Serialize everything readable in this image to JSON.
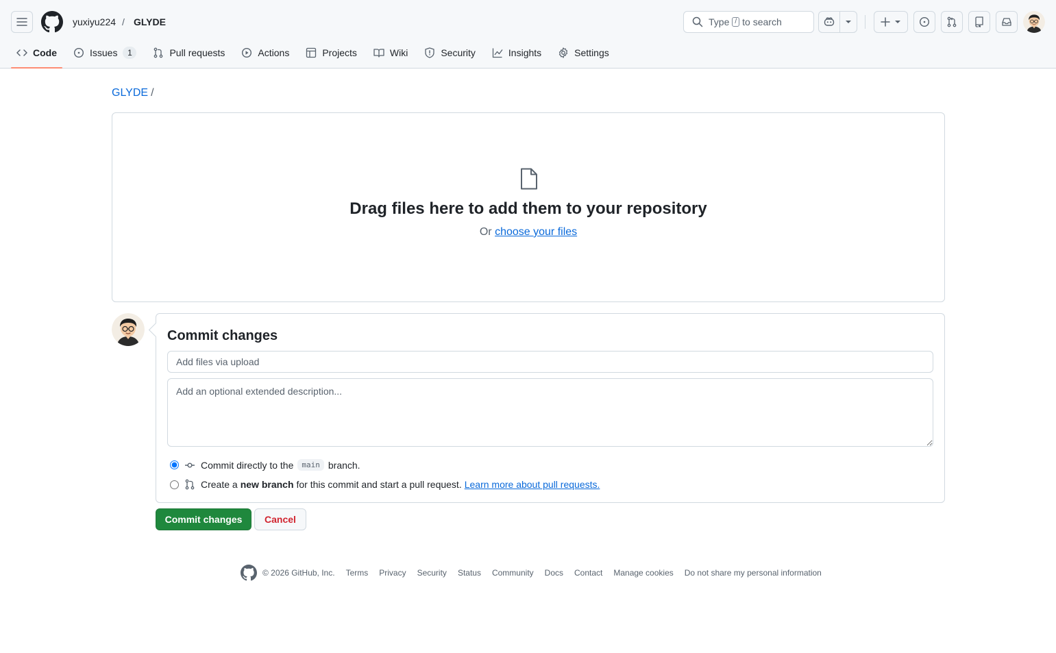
{
  "header": {
    "owner": "yuxiyu224",
    "separator": "/",
    "repo": "GLYDE",
    "search": {
      "prefix": "Type",
      "key": "/",
      "suffix": "to search"
    },
    "icons": [
      "hamburger-icon",
      "github-logo-icon",
      "search-icon",
      "copilot-icon",
      "chevron-down-icon",
      "plus-icon",
      "issue-opened-icon",
      "git-pull-request-icon",
      "repo-icon",
      "inbox-icon"
    ]
  },
  "nav": {
    "code": "Code",
    "issues": "Issues",
    "issues_count": "1",
    "pulls": "Pull requests",
    "actions": "Actions",
    "projects": "Projects",
    "wiki": "Wiki",
    "security": "Security",
    "insights": "Insights",
    "settings": "Settings"
  },
  "breadcrumb": {
    "repo": "GLYDE",
    "sep": "/"
  },
  "dropzone": {
    "title": "Drag files here to add them to your repository",
    "or": "Or",
    "choose": "choose your files"
  },
  "commit": {
    "title": "Commit changes",
    "message_placeholder": "Add files via upload",
    "description_placeholder": "Add an optional extended description...",
    "option1_prefix": "Commit directly to the",
    "option1_branch": "main",
    "option1_suffix": "branch.",
    "option2_prefix": "Create a",
    "option2_bold": "new branch",
    "option2_suffix": "for this commit and start a pull request.",
    "option2_link": "Learn more about pull requests.",
    "submit": "Commit changes",
    "cancel": "Cancel"
  },
  "footer": {
    "copyright": "© 2026 GitHub, Inc.",
    "links": [
      "Terms",
      "Privacy",
      "Security",
      "Status",
      "Community",
      "Docs",
      "Contact",
      "Manage cookies",
      "Do not share my personal information"
    ]
  },
  "colors": {
    "accent_link": "#0969da",
    "primary_button": "#1f883d",
    "danger_text": "#d1242f",
    "tab_underline": "#fd8c73"
  }
}
